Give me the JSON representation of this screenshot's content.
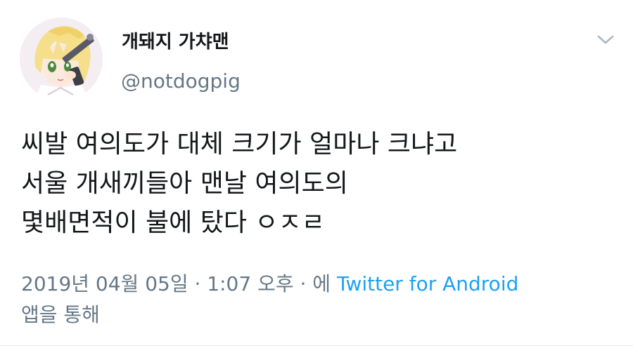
{
  "author": {
    "display_name": "개돼지 가챠맨",
    "handle": "@notdogpig",
    "avatar_icon": "anime-character-avatar"
  },
  "menu": {
    "icon": "chevron-down-icon"
  },
  "tweet": {
    "lines": [
      "씨발 여의도가 대체 크기가 얼마나 크냐고",
      "서울 개새끼들아 맨날 여의도의",
      "몇배면적이 불에 탔다 ㅇㅈㄹ"
    ]
  },
  "meta": {
    "timestamp": "2019년 04월 05일 · 1:07 오후 · 에 ",
    "source": "Twitter for Android",
    "suffix": "앱을 통해"
  },
  "colors": {
    "text": "#14171a",
    "secondary": "#657786",
    "link": "#1da1f2"
  }
}
